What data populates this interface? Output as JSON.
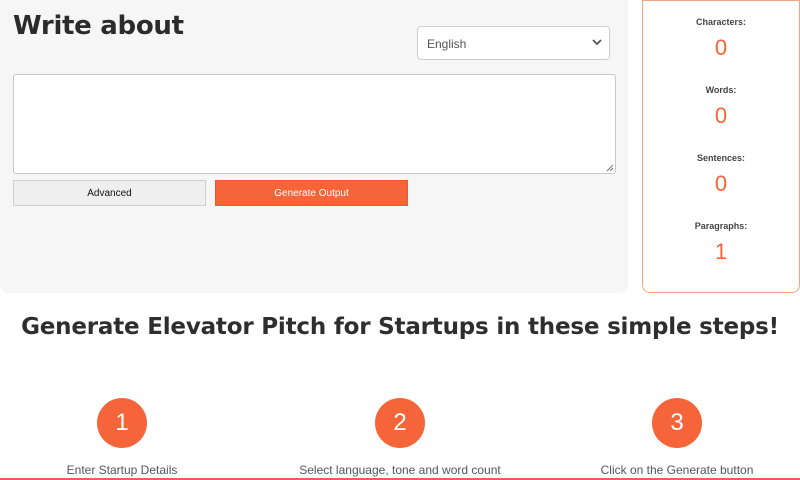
{
  "editor": {
    "title": "Write about",
    "language": {
      "selected": "English"
    },
    "textarea": {
      "value": "",
      "placeholder": ""
    },
    "advanced_label": "Advanced",
    "generate_label": "Generate Output"
  },
  "stats": {
    "characters": {
      "label": "Characters:",
      "value": "0"
    },
    "words": {
      "label": "Words:",
      "value": "0"
    },
    "sentences": {
      "label": "Sentences:",
      "value": "0"
    },
    "paragraphs": {
      "label": "Paragraphs:",
      "value": "1"
    }
  },
  "steps": {
    "heading": "Generate Elevator Pitch for Startups in these simple steps!",
    "items": [
      {
        "number": "1",
        "text": "Enter Startup Details"
      },
      {
        "number": "2",
        "text": "Select language, tone and word count"
      },
      {
        "number": "3",
        "text": "Click on the Generate button"
      }
    ]
  },
  "colors": {
    "accent": "#f6653a",
    "panel_bg": "#f6f6f6",
    "stats_border": "#f2a58b"
  },
  "icons": {
    "select_arrow": "chevron-down-icon",
    "resize": "resize-grip-icon"
  }
}
